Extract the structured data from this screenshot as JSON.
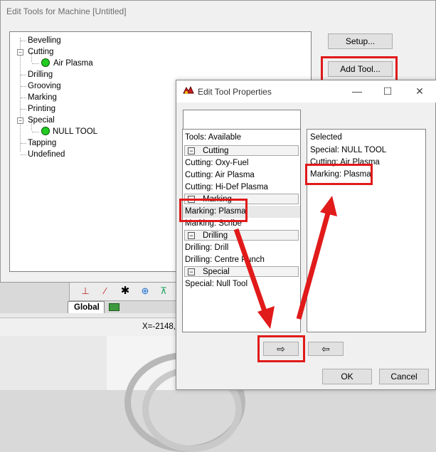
{
  "main_window": {
    "title": "Edit Tools for Machine [Untitled]",
    "tree": [
      {
        "label": "Bevelling"
      },
      {
        "label": "Cutting",
        "expanded": true,
        "children": [
          "Air Plasma"
        ]
      },
      {
        "label": "Drilling"
      },
      {
        "label": "Grooving"
      },
      {
        "label": "Marking"
      },
      {
        "label": "Printing"
      },
      {
        "label": "Special",
        "expanded": true,
        "children": [
          "NULL TOOL"
        ]
      },
      {
        "label": "Tapping"
      },
      {
        "label": "Undefined"
      }
    ],
    "setup_label": "Setup...",
    "add_tool_label": "Add Tool..."
  },
  "background": {
    "global_tab": "Global",
    "coords": "X=-2148,"
  },
  "dialog": {
    "title": "Edit Tool Properties",
    "window_controls": {
      "minimize": "—",
      "maximize": "☐",
      "close": "✕"
    },
    "filter_value": "",
    "available": {
      "header": "Tools: Available",
      "groups": [
        {
          "name": "Cutting",
          "items": [
            "Cutting: Oxy-Fuel",
            "Cutting: Air Plasma",
            "Cutting: Hi-Def Plasma"
          ]
        },
        {
          "name": "Marking",
          "items": [
            "Marking: Plasma",
            "Marking: Scribe"
          ]
        },
        {
          "name": "Drilling",
          "items": [
            "Drilling: Drill",
            "Drilling: Centre Punch"
          ]
        },
        {
          "name": "Special",
          "items": [
            "Special: Null Tool"
          ]
        }
      ]
    },
    "selected": {
      "header": "Selected",
      "items": [
        "Special: NULL TOOL",
        "Cutting: Air Plasma",
        "Marking: Plasma"
      ]
    },
    "add_arrow_icon": "right-arrow-icon",
    "remove_arrow_icon": "left-arrow-icon",
    "add_arrow_glyph": "⇨",
    "remove_arrow_glyph": "⇦",
    "ok_label": "OK",
    "cancel_label": "Cancel"
  },
  "colors": {
    "highlight_red": "#e11a1a",
    "tool_active_green": "#22cc22"
  }
}
